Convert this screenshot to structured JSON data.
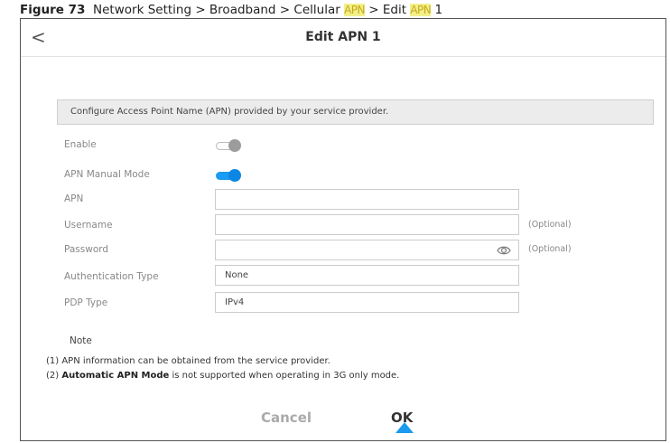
{
  "caption": {
    "figure": "Figure 73",
    "path_prefix": "Network Setting > Broadband > Cellular ",
    "apn1": "APN",
    "mid": " > Edit ",
    "apn2": "APN",
    "suffix": " 1"
  },
  "header": {
    "back_symbol": "<",
    "title": "Edit APN 1"
  },
  "banner": "Configure Access Point Name (APN) provided by your service provider.",
  "form": {
    "enable": {
      "label": "Enable",
      "state": "off"
    },
    "apn_manual_mode": {
      "label": "APN Manual Mode",
      "state": "on"
    },
    "apn": {
      "label": "APN",
      "value": ""
    },
    "username": {
      "label": "Username",
      "value": "",
      "hint": "(Optional)"
    },
    "password": {
      "label": "Password",
      "value": "",
      "hint": "(Optional)",
      "icon": "eye-icon"
    },
    "auth_type": {
      "label": "Authentication Type",
      "value": "None"
    },
    "pdp_type": {
      "label": "PDP Type",
      "value": "IPv4"
    }
  },
  "note": {
    "title": "Note",
    "line1": "(1) APN information can be obtained from the service provider.",
    "line2_prefix": "(2) ",
    "line2_bold": "Automatic APN Mode",
    "line2_rest": " is not supported when operating in 3G only mode."
  },
  "buttons": {
    "cancel": "Cancel",
    "ok": "OK"
  },
  "colors": {
    "accent": "#1a9af0",
    "banner_bg": "#ececec",
    "highlight": "#f3f08a"
  }
}
